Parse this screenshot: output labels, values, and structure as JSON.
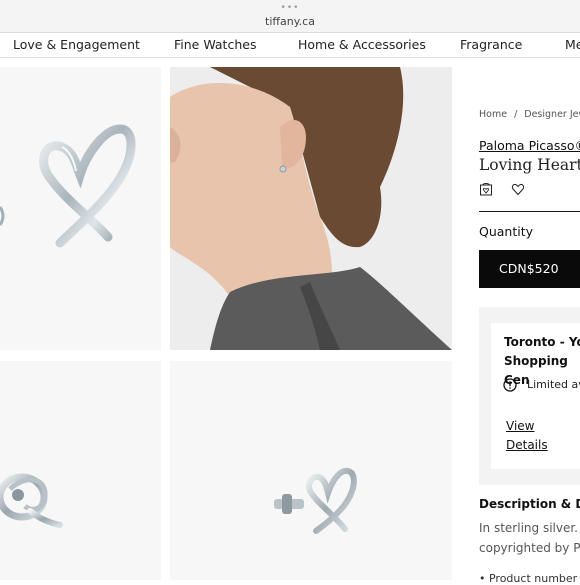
{
  "browser": {
    "dots": "•••",
    "url": "tiffany.ca"
  },
  "nav": {
    "items": [
      "Love & Engagement",
      "Fine Watches",
      "Home & Accessories",
      "Fragrance",
      "Me"
    ]
  },
  "breadcrumb": {
    "home": "Home",
    "separator": "/",
    "current": "Designer Jewe"
  },
  "product": {
    "collection": "Paloma Picasso®",
    "title": "Loving Heart Ea",
    "quantity_label": "Quantity",
    "price_button": "CDN$520"
  },
  "store": {
    "name_line1": "Toronto - Yor",
    "name_line2": "Shopping Cen",
    "availability": "Limited ava",
    "details_line1": "View",
    "details_line2": "Details"
  },
  "description": {
    "heading": "Description & Deta",
    "line1": "In  sterling  silver.",
    "line2": "copyrighted by Pa",
    "bullet": "• Product number"
  },
  "icons": {
    "save": "bag-heart-icon",
    "wishlist": "heart-icon",
    "availability": "exclamation-circle-icon"
  },
  "colors": {
    "button_bg": "#0a0a0a",
    "tile_bg": "#f7f7f7",
    "panel_bg": "#f3f3f3"
  }
}
